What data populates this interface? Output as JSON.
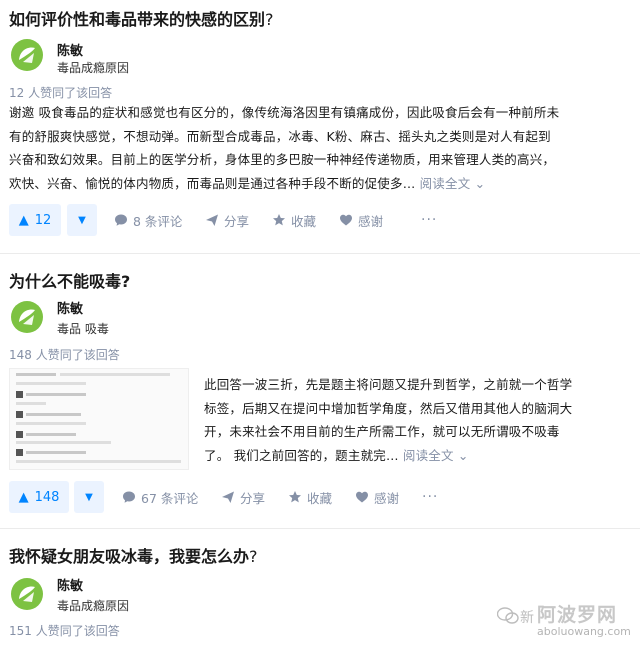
{
  "colors": {
    "accent": "#0084ff",
    "muted": "#8590a6",
    "vote_bg": "#ebf3ff",
    "avatar_green": "#7dc242"
  },
  "answers": [
    {
      "question": "如何评价性和毒品带来的快感的区别",
      "question_mark": "?",
      "author": "陈敏",
      "bio": "毒品成瘾原因",
      "votes_text": "12 人赞同了该回答",
      "body_lines": [
        "谢邀 吸食毒品的症状和感觉也有区分的，像传统海洛因里有镇痛成份，因此吸食后会有一种前所未",
        "有的舒服爽快感觉，不想动弹。而新型合成毒品，冰毒、K粉、麻古、摇头丸之类则是对人有起到",
        "兴奋和致幻效果。目前上的医学分析，身体里的多巴胺一种神经传递物质，用来管理人类的高兴，",
        "欢快、兴奋、愉悦的体内物质，而毒品则是通过各种手段不断的促使多…"
      ],
      "read_more": "阅读全文",
      "upvote_count": "12",
      "comments": "8 条评论",
      "share": "分享",
      "favorite": "收藏",
      "thanks": "感谢",
      "more": "···"
    },
    {
      "question": "为什么不能吸毒?",
      "author": "陈敏",
      "bio": "毒品 吸毒",
      "votes_text": "148 人赞同了该回答",
      "body_lines": [
        "此回答一波三折，先是题主将问题又提升到哲学，之前就一个哲学",
        "标签，后期又在提问中增加哲学角度，然后又借用其他人的脑洞大",
        "开，未来社会不用目前的生产所需工作，就可以无所谓吸不吸毒",
        "了。 我们之前回答的，题主就完…"
      ],
      "read_more": "阅读全文",
      "upvote_count": "148",
      "comments": "67 条评论",
      "share": "分享",
      "favorite": "收藏",
      "thanks": "感谢",
      "more": "···"
    },
    {
      "question": "我怀疑女朋友吸冰毒，我要怎么办",
      "question_mark": "?",
      "author": "陈敏",
      "bio": "毒品成瘾原因",
      "votes_text": "151 人赞同了该回答"
    }
  ],
  "watermark": {
    "site_cn": "阿波罗网",
    "site_en": "aboluowang.com",
    "sub": "新"
  }
}
